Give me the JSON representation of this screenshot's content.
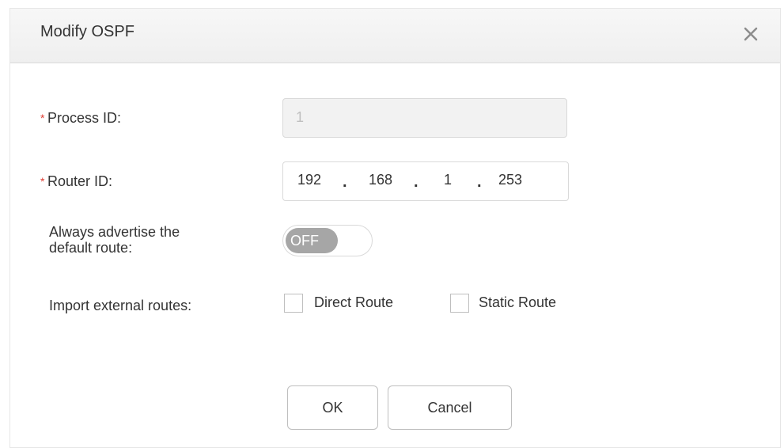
{
  "dialog": {
    "title": "Modify OSPF",
    "close_icon": "close-icon"
  },
  "form": {
    "required_mark": "*",
    "process_id": {
      "label": "Process ID:",
      "value": "1",
      "disabled": true
    },
    "router_id": {
      "label": "Router ID:",
      "octets": [
        "192",
        "168",
        "1",
        "253"
      ],
      "separator": "."
    },
    "default_route": {
      "label_line1": "Always advertise the",
      "label_line2": "default route:",
      "toggle_state": "OFF"
    },
    "external_routes": {
      "label": "Import external routes:",
      "options": [
        {
          "label": "Direct Route",
          "checked": false
        },
        {
          "label": "Static Route",
          "checked": false
        }
      ]
    }
  },
  "buttons": {
    "ok": "OK",
    "cancel": "Cancel"
  },
  "colors": {
    "required": "#e03c31",
    "toggle_off": "#a6a6a6",
    "disabled_bg": "#f2f2f2"
  }
}
